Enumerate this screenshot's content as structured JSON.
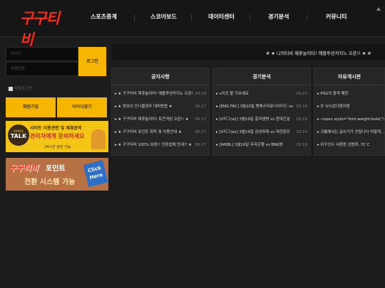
{
  "header": {
    "logo_text": "구구티비",
    "nav": [
      "스포츠중계",
      "스코어보드",
      "데이터센터",
      "경기분석",
      "커뮤니티"
    ]
  },
  "login": {
    "id_placeholder": "아이디",
    "pw_placeholder": "비밀번호",
    "login_label": "로그인",
    "remember_label": "자동로그인",
    "signup_label": "회원가입",
    "find_id_label": "아이디찾기"
  },
  "banners": {
    "kakao": {
      "logo_small": "KAKAO",
      "logo_big": "TALK",
      "line1": "사이트 이용관련 및 제휴문의",
      "line2": "관리자에게 문의하세요",
      "line3": "24시간 상담 가능"
    },
    "point": {
      "brand": "구구티비",
      "word": "포인트",
      "line2": "전환 시스템 가능",
      "click_label": "Click Here"
    }
  },
  "notice_ticker": "# ★ 니어티비 제휴놀이터! 에볼루션카지노 오픈!! ★ #",
  "boards": [
    {
      "title": "공지사항",
      "rows": [
        {
          "text": "★ 구구티비 제휴놀이터! 에볼루션카지노 오픈!! ★",
          "date": "03.19"
        },
        {
          "text": "★ 땅상이 안니울경우 대처방법 ★",
          "date": "05.17"
        },
        {
          "text": "★ 구구티비 제휴놀이터! 토큰게임 오픈!! ★",
          "date": "05.17"
        },
        {
          "text": "★ 구구티비 포인트 획득 및 이용안내 ★",
          "date": "05.17"
        },
        {
          "text": "★ 구구티비 100% 보증!! 인증업체 안내!! ★",
          "date": "05.17"
        }
      ]
    },
    {
      "title": "경기분석",
      "rows": [
        {
          "text": "v이곳 할 가보세요",
          "date": "03.23"
        },
        {
          "text": "[ENG FAC] 3월20일 맨체스터유나이티드 vs ...",
          "date": "03.19"
        },
        {
          "text": "[V리그(w)] 3월19일 흥국생명 vs 현대건설",
          "date": "03.19"
        },
        {
          "text": "[V리그(w)] 3월19일 삼성화재 vs 대한항공",
          "date": "03.19"
        },
        {
          "text": "[WKBL] 3월19일 우리은행 vs BNK썸",
          "date": "03.19"
        }
      ]
    },
    {
      "title": "자유게시판",
      "rows": [
        {
          "text": "PSG의 충격 패한",
          "date": ""
        },
        {
          "text": "또 낚시갔다왔어용",
          "date": ""
        },
        {
          "text": "<span style=\"font-weight:bold;\">크롬에서",
          "date": ""
        },
        {
          "text": "크롬에서는 글쓰기가 안됩니다 이렇게 ...",
          "date": ""
        },
        {
          "text": "이구선수 서혼등 상범최..7C C",
          "date": ""
        }
      ]
    }
  ],
  "colors": {
    "accent_yellow": "#f6b600",
    "logo_red": "#ff2a1a",
    "background": "#1c1c1c"
  }
}
